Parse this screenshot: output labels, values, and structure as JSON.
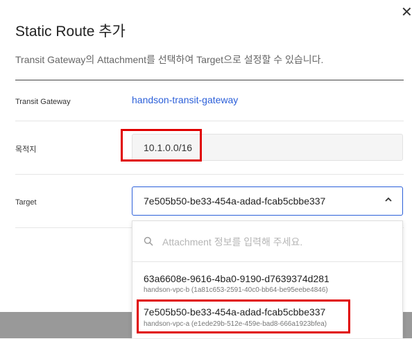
{
  "dialog": {
    "title": "Static Route 추가",
    "description": "Transit Gateway의 Attachment를 선택하여 Target으로 설정할 수 있습니다.",
    "close_icon": "close-icon"
  },
  "form": {
    "transit_gateway": {
      "label": "Transit Gateway",
      "value": "handson-transit-gateway"
    },
    "destination": {
      "label": "목적지",
      "value": "10.1.0.0/16"
    },
    "target": {
      "label": "Target",
      "selected": "7e505b50-be33-454a-adad-fcab5cbbe337",
      "icon": "chevron-up-icon"
    }
  },
  "dropdown": {
    "search_placeholder": "Attachment 정보를 입력해 주세요.",
    "search_icon": "search-icon",
    "options": [
      {
        "id": "63a6608e-9616-4ba0-9190-d7639374d281",
        "sub": "handson-vpc-b (1a81c653-2591-40c0-bb64-be95eebe4846)"
      },
      {
        "id": "7e505b50-be33-454a-adad-fcab5cbbe337",
        "sub": "handson-vpc-a (e1ede29b-512e-459e-bad8-666a1923bfea)"
      }
    ]
  },
  "colors": {
    "link": "#2b5fd9",
    "select_border": "#2b5fd9",
    "highlight": "#e00000",
    "backdrop": "#999999"
  }
}
